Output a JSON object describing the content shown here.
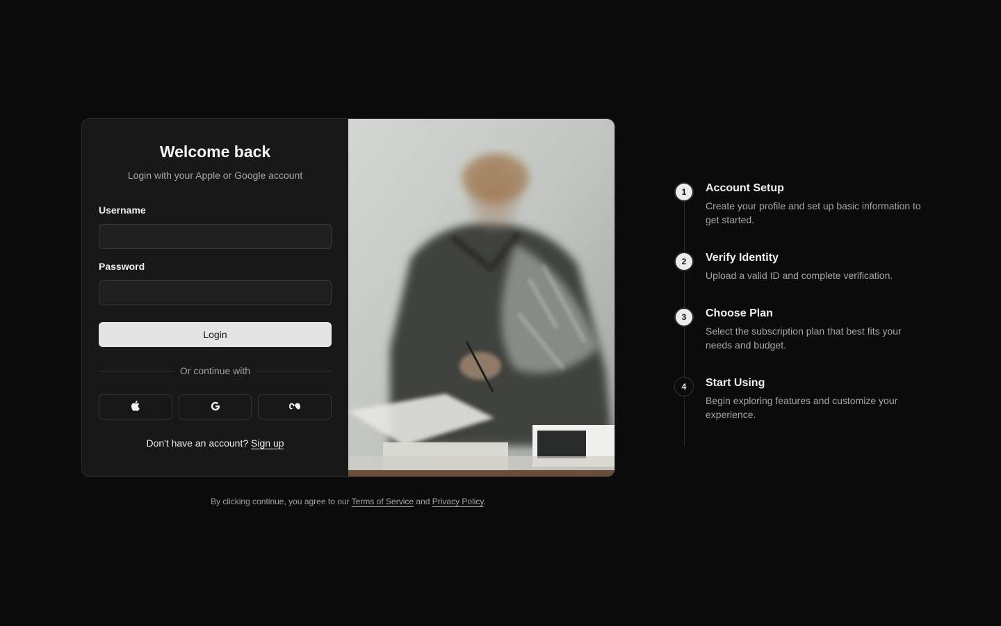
{
  "login": {
    "title": "Welcome back",
    "subtitle": "Login with your Apple or Google account",
    "username_label": "Username",
    "password_label": "Password",
    "login_button": "Login",
    "divider_text": "Or continue with",
    "signup_prompt": "Don't have an account?",
    "signup_link": "Sign up"
  },
  "social_icons": [
    "apple-icon",
    "google-icon",
    "meta-icon"
  ],
  "legal": {
    "prefix": "By clicking continue, you agree to our",
    "terms": "Terms of Service",
    "and": "and",
    "privacy": "Privacy Policy",
    "suffix": "."
  },
  "steps": [
    {
      "number": "1",
      "title": "Account Setup",
      "description": "Create your profile and set up basic information to get started."
    },
    {
      "number": "2",
      "title": "Verify Identity",
      "description": "Upload a valid ID and complete verification."
    },
    {
      "number": "3",
      "title": "Choose Plan",
      "description": "Select the subscription plan that best fits your needs and budget."
    },
    {
      "number": "4",
      "title": "Start Using",
      "description": "Begin exploring features and customize your experience."
    }
  ],
  "colors": {
    "background": "#0b0b0b",
    "card": "#181818",
    "button_light": "#e4e4e4",
    "muted_text": "#a6a6a6"
  }
}
